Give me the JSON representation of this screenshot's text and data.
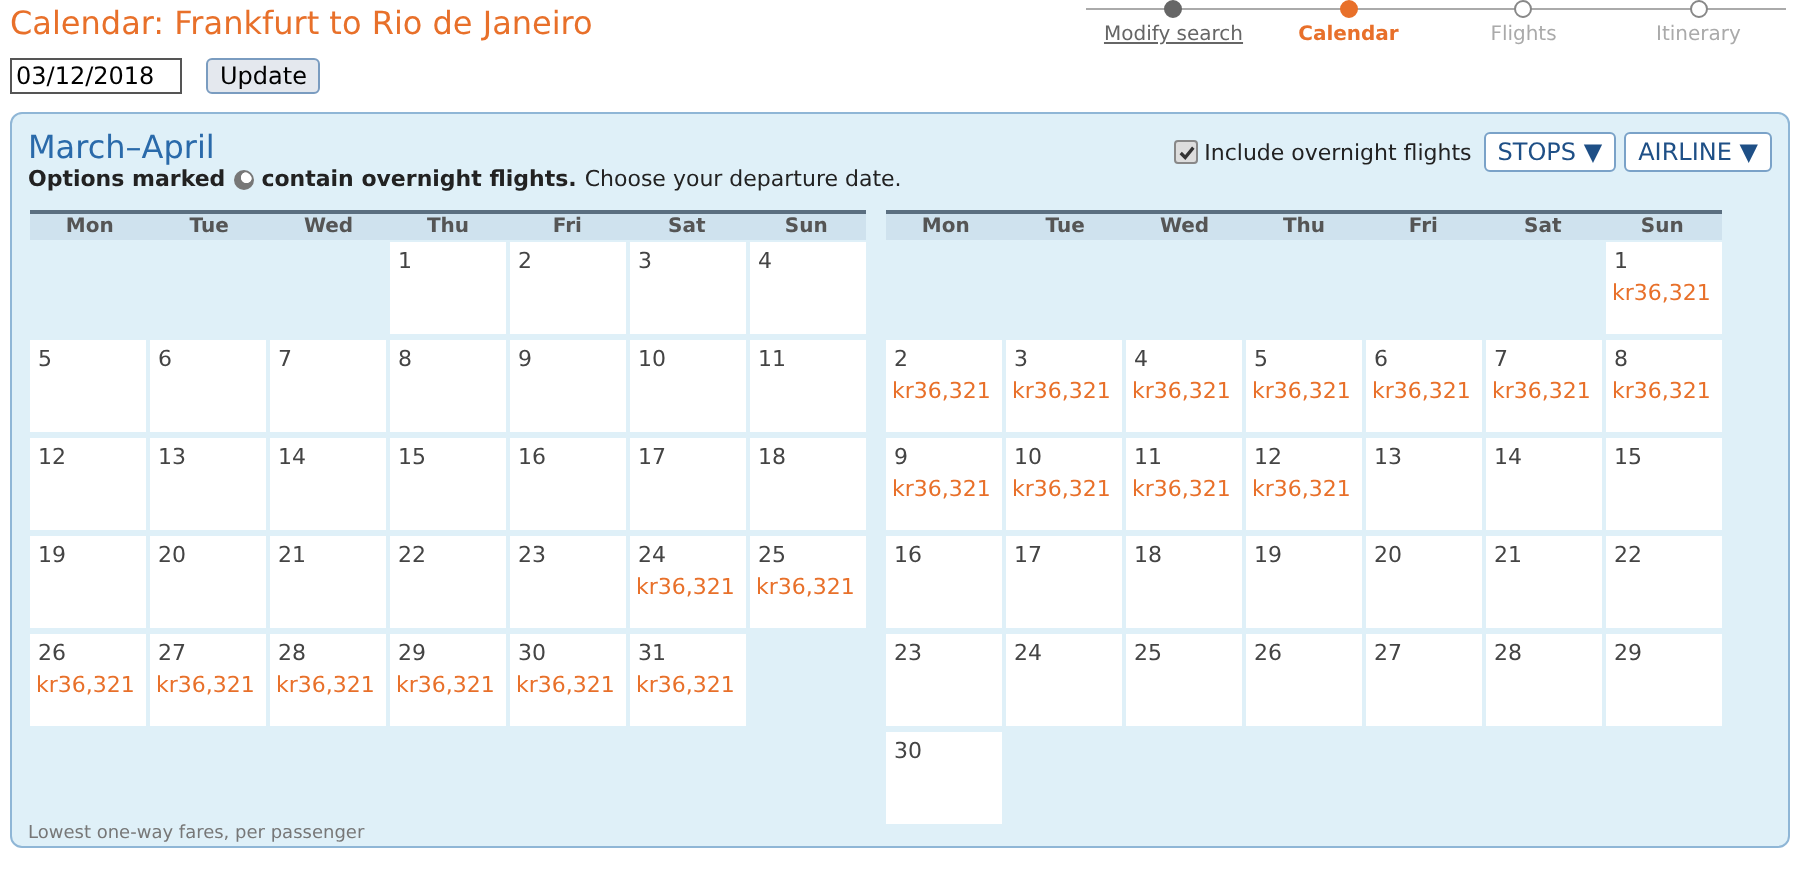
{
  "title": "Calendar: Frankfurt to Rio de Janeiro",
  "steps": [
    {
      "label": "Modify search",
      "completed": true,
      "selected": false
    },
    {
      "label": "Calendar",
      "completed": false,
      "selected": true
    },
    {
      "label": "Flights",
      "completed": false,
      "selected": false
    },
    {
      "label": "Itinerary",
      "completed": false,
      "selected": false
    }
  ],
  "date_field": {
    "value": "03/12/2018"
  },
  "update_button": "Update",
  "panel": {
    "heading": "March–April",
    "note_bold_1": "Options marked",
    "note_bold_2": "contain overnight flights.",
    "note_rest": "Choose your departure date.",
    "overnight_checkbox": {
      "label": "Include overnight flights",
      "checked": true
    },
    "filters": [
      {
        "label": "STOPS",
        "caret": "▼"
      },
      {
        "label": "AIRLINE",
        "caret": "▼"
      }
    ],
    "footer": "Lowest one-way fares, per passenger"
  },
  "months": [
    {
      "weekdays": [
        "Mon",
        "Tue",
        "Wed",
        "Thu",
        "Fri",
        "Sat",
        "Sun"
      ],
      "weeks": [
        [
          {
            "kind": "blank"
          },
          {
            "kind": "blank"
          },
          {
            "kind": "blank"
          },
          {
            "kind": "day",
            "day": "1"
          },
          {
            "kind": "day",
            "day": "2"
          },
          {
            "kind": "day",
            "day": "3"
          },
          {
            "kind": "day",
            "day": "4"
          }
        ],
        [
          {
            "kind": "day",
            "day": "5"
          },
          {
            "kind": "day",
            "day": "6"
          },
          {
            "kind": "day",
            "day": "7"
          },
          {
            "kind": "day",
            "day": "8"
          },
          {
            "kind": "day",
            "day": "9"
          },
          {
            "kind": "day",
            "day": "10"
          },
          {
            "kind": "day",
            "day": "11"
          }
        ],
        [
          {
            "kind": "day",
            "day": "12"
          },
          {
            "kind": "day",
            "day": "13"
          },
          {
            "kind": "day",
            "day": "14"
          },
          {
            "kind": "day",
            "day": "15"
          },
          {
            "kind": "day",
            "day": "16"
          },
          {
            "kind": "day",
            "day": "17"
          },
          {
            "kind": "day",
            "day": "18"
          }
        ],
        [
          {
            "kind": "day",
            "day": "19"
          },
          {
            "kind": "day",
            "day": "20"
          },
          {
            "kind": "day",
            "day": "21"
          },
          {
            "kind": "day",
            "day": "22"
          },
          {
            "kind": "day",
            "day": "23"
          },
          {
            "kind": "day",
            "day": "24",
            "fare": "kr36,321"
          },
          {
            "kind": "day",
            "day": "25",
            "fare": "kr36,321"
          }
        ],
        [
          {
            "kind": "day",
            "day": "26",
            "fare": "kr36,321"
          },
          {
            "kind": "day",
            "day": "27",
            "fare": "kr36,321"
          },
          {
            "kind": "day",
            "day": "28",
            "fare": "kr36,321"
          },
          {
            "kind": "day",
            "day": "29",
            "fare": "kr36,321"
          },
          {
            "kind": "day",
            "day": "30",
            "fare": "kr36,321"
          },
          {
            "kind": "day",
            "day": "31",
            "fare": "kr36,321"
          },
          {
            "kind": "blank"
          }
        ]
      ]
    },
    {
      "weekdays": [
        "Mon",
        "Tue",
        "Wed",
        "Thu",
        "Fri",
        "Sat",
        "Sun"
      ],
      "weeks": [
        [
          {
            "kind": "blank"
          },
          {
            "kind": "blank"
          },
          {
            "kind": "blank"
          },
          {
            "kind": "blank"
          },
          {
            "kind": "blank"
          },
          {
            "kind": "blank"
          },
          {
            "kind": "day",
            "day": "1",
            "fare": "kr36,321"
          }
        ],
        [
          {
            "kind": "day",
            "day": "2",
            "fare": "kr36,321"
          },
          {
            "kind": "day",
            "day": "3",
            "fare": "kr36,321"
          },
          {
            "kind": "day",
            "day": "4",
            "fare": "kr36,321"
          },
          {
            "kind": "day",
            "day": "5",
            "fare": "kr36,321"
          },
          {
            "kind": "day",
            "day": "6",
            "fare": "kr36,321"
          },
          {
            "kind": "day",
            "day": "7",
            "fare": "kr36,321"
          },
          {
            "kind": "day",
            "day": "8",
            "fare": "kr36,321"
          }
        ],
        [
          {
            "kind": "day",
            "day": "9",
            "fare": "kr36,321"
          },
          {
            "kind": "day",
            "day": "10",
            "fare": "kr36,321"
          },
          {
            "kind": "day",
            "day": "11",
            "fare": "kr36,321"
          },
          {
            "kind": "day",
            "day": "12",
            "fare": "kr36,321"
          },
          {
            "kind": "day",
            "day": "13"
          },
          {
            "kind": "day",
            "day": "14"
          },
          {
            "kind": "day",
            "day": "15"
          }
        ],
        [
          {
            "kind": "day",
            "day": "16"
          },
          {
            "kind": "day",
            "day": "17"
          },
          {
            "kind": "day",
            "day": "18"
          },
          {
            "kind": "day",
            "day": "19"
          },
          {
            "kind": "day",
            "day": "20"
          },
          {
            "kind": "day",
            "day": "21"
          },
          {
            "kind": "day",
            "day": "22"
          }
        ],
        [
          {
            "kind": "day",
            "day": "23"
          },
          {
            "kind": "day",
            "day": "24"
          },
          {
            "kind": "day",
            "day": "25"
          },
          {
            "kind": "day",
            "day": "26"
          },
          {
            "kind": "day",
            "day": "27"
          },
          {
            "kind": "day",
            "day": "28"
          },
          {
            "kind": "day",
            "day": "29"
          }
        ],
        [
          {
            "kind": "day",
            "day": "30"
          },
          {
            "kind": "blank"
          },
          {
            "kind": "blank"
          },
          {
            "kind": "blank"
          },
          {
            "kind": "blank"
          },
          {
            "kind": "blank"
          },
          {
            "kind": "blank"
          }
        ]
      ]
    }
  ]
}
